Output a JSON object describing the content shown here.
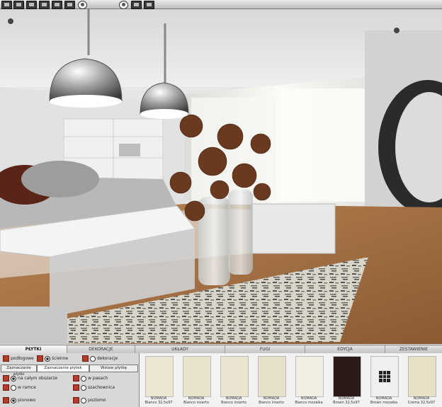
{
  "toolbar": {
    "buttons": [
      "new-icon",
      "open-icon",
      "save-icon",
      "print-icon",
      "export-icon",
      "settings-icon",
      "lock-icon"
    ],
    "view_buttons": [
      "camera-icon",
      "render-icon",
      "view-icon"
    ]
  },
  "tabs": [
    {
      "label": "PŁYTKI",
      "active": true
    },
    {
      "label": "DEKORACJE",
      "active": false
    },
    {
      "label": "UKŁADY",
      "active": false
    },
    {
      "label": "FUGI",
      "active": false
    },
    {
      "label": "EDYCJA",
      "active": false
    },
    {
      "label": "ZESTAWIENIE",
      "active": false
    }
  ],
  "panel": {
    "options": {
      "floor_label": "podłogowe",
      "wall_label": "ścienne",
      "decor_label": "dekoracje"
    },
    "subtabs": [
      "Zaznaczanie płytki",
      "Zaznaczanie płytek",
      "Wstaw płytkę"
    ],
    "placement": {
      "whole": "na całym obszarze",
      "strips": "w pasach",
      "frame": "w ramce",
      "checker": "szachownica",
      "vertical": "pionowo",
      "horizontal": "poziomo"
    }
  },
  "tiles": [
    {
      "brand": "NOMADA",
      "name": "Bianco 32,5x97",
      "color": "#ece6d2"
    },
    {
      "brand": "NOMADA",
      "name": "Bianco inserto",
      "color": "#e9e2cc"
    },
    {
      "brand": "NOMADA",
      "name": "Bianco inserto",
      "color": "#eae4d0"
    },
    {
      "brand": "NOMADA",
      "name": "Bianco inserto",
      "color": "#e6dfca"
    },
    {
      "brand": "NOMADA",
      "name": "Bianco mozaika",
      "color": "#f1ede2"
    },
    {
      "brand": "NOMADA",
      "name": "Brown 32,5x97",
      "color": "#2b1b16"
    },
    {
      "brand": "NOMADA",
      "name": "Brown mozaika",
      "color": "#efefef"
    },
    {
      "brand": "NOMADA",
      "name": "Crema 32,5x97",
      "color": "#e7dfc6"
    }
  ]
}
